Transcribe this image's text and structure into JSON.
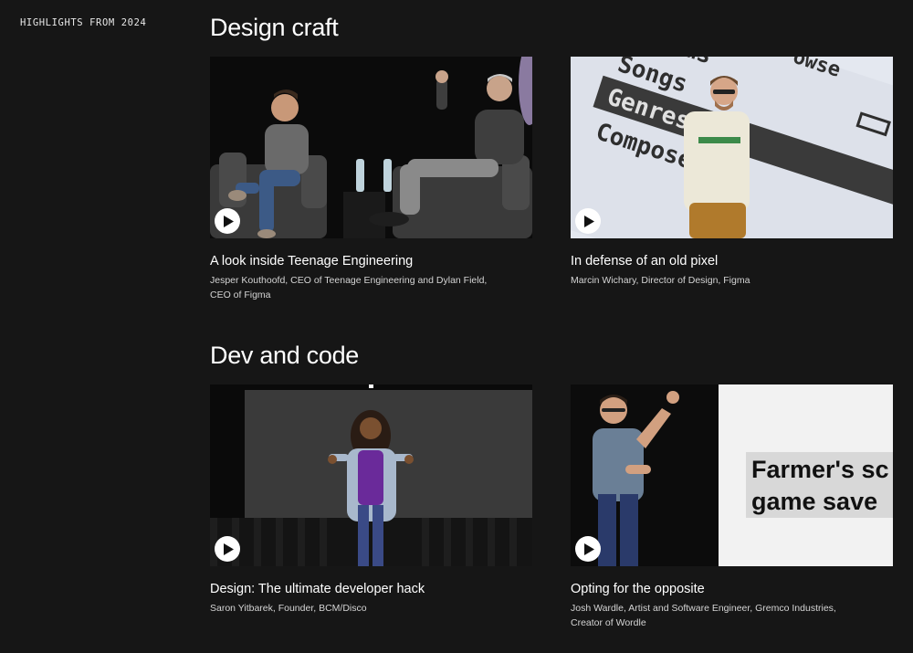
{
  "eyebrow": "HIGHLIGHTS FROM 2024",
  "sections": [
    {
      "title": "Design craft",
      "cards": [
        {
          "title": "A look inside Teenage Engineering",
          "subtitle": "Jesper Kouthoofd, CEO of Teenage Engineering and Dylan Field, CEO of Figma"
        },
        {
          "title": "In defense of an old pixel",
          "subtitle": "Marcin Wichary, Director of Design, Figma",
          "screen_words": [
            "umbums",
            "owse",
            "Songs",
            "Genres",
            "Composers"
          ]
        }
      ]
    },
    {
      "title": "Dev and code",
      "cards": [
        {
          "title": "Design: The ultimate developer hack",
          "subtitle": "Saron Yitbarek, Founder, BCM/Disco"
        },
        {
          "title": "Opting for the opposite",
          "subtitle": "Josh Wardle, Artist and Software Engineer, Gremco Industries, Creator of Wordle",
          "slide_line1": "Farmer's sc",
          "slide_line2": "game save"
        }
      ]
    }
  ]
}
